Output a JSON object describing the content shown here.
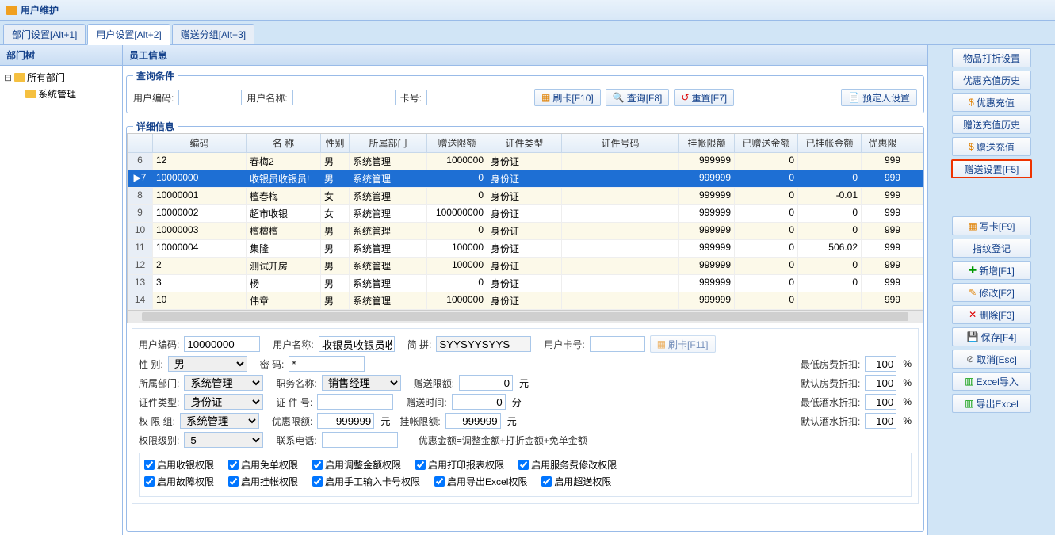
{
  "window": {
    "title": "用户维护"
  },
  "tabs": [
    {
      "label": "部门设置[Alt+1]"
    },
    {
      "label": "用户设置[Alt+2]"
    },
    {
      "label": "赠送分组[Alt+3]"
    }
  ],
  "tree": {
    "title": "部门树",
    "root": "所有部门",
    "child": "系统管理"
  },
  "employee": {
    "title": "员工信息",
    "query": {
      "legend": "查询条件",
      "usercode_label": "用户编码:",
      "username_label": "用户名称:",
      "cardno_label": "卡号:",
      "swipe": "刷卡[F10]",
      "search": "查询[F8]",
      "reset": "重置[F7]",
      "booker": "预定人设置"
    },
    "detail_legend": "详细信息",
    "columns": {
      "code": "编码",
      "name": "名 称",
      "sex": "性别",
      "dept": "所属部门",
      "zsxe": "赠送限额",
      "idtype": "证件类型",
      "idno": "证件号码",
      "gzxe": "挂帐限额",
      "yzs": "已赠送金额",
      "ygz": "已挂帐金额",
      "yhx": "优惠限"
    },
    "rows": [
      {
        "n": "6",
        "code": "12",
        "name": "春梅2",
        "sex": "男",
        "dept": "系统管理",
        "zsxe": "1000000",
        "idtype": "身份证",
        "idno": "",
        "gzxe": "999999",
        "yzs": "0",
        "ygz": "",
        "yhx": "999"
      },
      {
        "n": "7",
        "code": "10000000",
        "name": "收银员收银员!",
        "sex": "男",
        "dept": "系统管理",
        "zsxe": "0",
        "idtype": "身份证",
        "idno": "",
        "gzxe": "999999",
        "yzs": "0",
        "ygz": "0",
        "yhx": "999",
        "selected": true
      },
      {
        "n": "8",
        "code": "10000001",
        "name": "檀春梅",
        "sex": "女",
        "dept": "系统管理",
        "zsxe": "0",
        "idtype": "身份证",
        "idno": "",
        "gzxe": "999999",
        "yzs": "0",
        "ygz": "-0.01",
        "yhx": "999"
      },
      {
        "n": "9",
        "code": "10000002",
        "name": "超市收银",
        "sex": "女",
        "dept": "系统管理",
        "zsxe": "100000000",
        "idtype": "身份证",
        "idno": "",
        "gzxe": "999999",
        "yzs": "0",
        "ygz": "0",
        "yhx": "999"
      },
      {
        "n": "10",
        "code": "10000003",
        "name": "檀檀檀",
        "sex": "男",
        "dept": "系统管理",
        "zsxe": "0",
        "idtype": "身份证",
        "idno": "",
        "gzxe": "999999",
        "yzs": "0",
        "ygz": "0",
        "yhx": "999"
      },
      {
        "n": "11",
        "code": "10000004",
        "name": "集隆",
        "sex": "男",
        "dept": "系统管理",
        "zsxe": "100000",
        "idtype": "身份证",
        "idno": "",
        "gzxe": "999999",
        "yzs": "0",
        "ygz": "506.02",
        "yhx": "999"
      },
      {
        "n": "12",
        "code": "2",
        "name": "测试开房",
        "sex": "男",
        "dept": "系统管理",
        "zsxe": "100000",
        "idtype": "身份证",
        "idno": "",
        "gzxe": "999999",
        "yzs": "0",
        "ygz": "0",
        "yhx": "999"
      },
      {
        "n": "13",
        "code": "3",
        "name": "杨",
        "sex": "男",
        "dept": "系统管理",
        "zsxe": "0",
        "idtype": "身份证",
        "idno": "",
        "gzxe": "999999",
        "yzs": "0",
        "ygz": "0",
        "yhx": "999"
      },
      {
        "n": "14",
        "code": "10",
        "name": "伟章",
        "sex": "男",
        "dept": "系统管理",
        "zsxe": "1000000",
        "idtype": "身份证",
        "idno": "",
        "gzxe": "999999",
        "yzs": "0",
        "ygz": "",
        "yhx": "999"
      }
    ]
  },
  "form": {
    "usercode_label": "用户编码:",
    "usercode": "10000000",
    "username_label": "用户名称:",
    "username": "收银员收银员收",
    "pinyin_label": "简    拼:",
    "pinyin": "SYYSYYSYYS",
    "cardno_label": "用户卡号:",
    "cardno": "",
    "swipe": "刷卡[F11]",
    "sex_label": "性    别:",
    "sex": "男",
    "pwd_label": "密    码:",
    "pwd": "*",
    "minroom_label": "最低房费折扣:",
    "minroom": "100",
    "dept_label": "所属部门:",
    "dept": "系统管理",
    "jobtitle_label": "职务名称:",
    "jobtitle": "销售经理",
    "zsxe_label": "赠送限额:",
    "zsxe": "0",
    "defroom_label": "默认房费折扣:",
    "defroom": "100",
    "idtype_label": "证件类型:",
    "idtype": "身份证",
    "idno_label": "证 件 号:",
    "idno": "",
    "zssj_label": "赠送时间:",
    "zssj": "0",
    "minwine_label": "最低酒水折扣:",
    "minwine": "100",
    "rolegroup_label": "权 限 组:",
    "rolegroup": "系统管理",
    "yhxe_label": "优惠限额:",
    "yhxe": "999999",
    "gzxe_label": "挂帐限额:",
    "gzxe": "999999",
    "defwine_label": "默认酒水折扣:",
    "defwine": "100",
    "rolelevel_label": "权限级别:",
    "rolelevel": "5",
    "phone_label": "联系电话:",
    "phone": "",
    "note": "优惠金额=调整金额+打折金额+免单金额",
    "unit_yuan": "元",
    "unit_fen": "分",
    "pct": "%",
    "perms": {
      "cashier": "启用收银权限",
      "freebill": "启用免单权限",
      "adjust": "启用调整金额权限",
      "printreport": "启用打印报表权限",
      "svcfee": "启用服务费修改权限",
      "fault": "启用故障权限",
      "onaccount": "启用挂帐权限",
      "manualcard": "启用手工输入卡号权限",
      "exportexcel": "启用导出Excel权限",
      "oversell": "启用超送权限"
    }
  },
  "sidebtns": {
    "discount": "物品打折设置",
    "youhui_hist": "优惠充值历史",
    "youhui_cz": "优惠充值",
    "zs_hist": "赠送充值历史",
    "zs_cz": "赠送充值",
    "zs_setting": "赠送设置[F5]",
    "writecard": "写卡[F9]",
    "finger": "指纹登记",
    "add": "新增[F1]",
    "edit": "修改[F2]",
    "delete": "删除[F3]",
    "save": "保存[F4]",
    "cancel": "取消[Esc]",
    "excelimport": "Excel导入",
    "excelexport": "导出Excel"
  }
}
